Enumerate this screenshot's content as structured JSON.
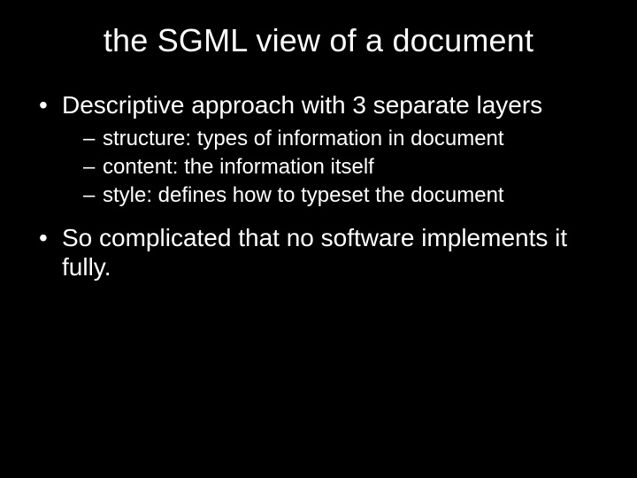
{
  "title": "the SGML view of a document",
  "bullets": [
    {
      "text": "Descriptive approach with 3 separate layers",
      "sub": [
        "structure: types of information in document",
        "content: the information itself",
        "style: defines how to typeset the document"
      ]
    },
    {
      "text": "So complicated that no software implements it fully.",
      "sub": []
    }
  ]
}
